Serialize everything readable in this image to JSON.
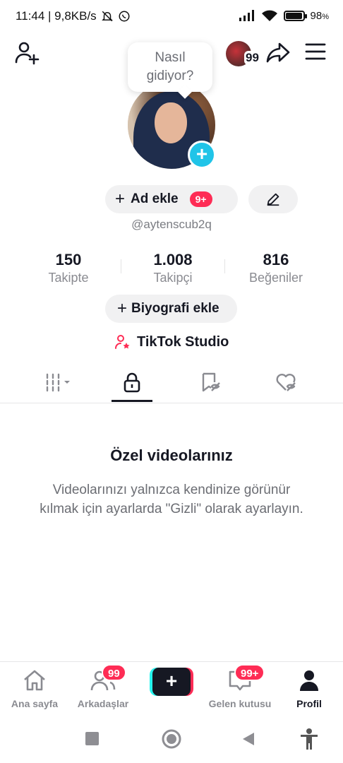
{
  "status_bar": {
    "time_info": "11:44 | 9,8KB/s",
    "battery": "98",
    "battery_suffix": "%",
    "battery_level": 0.98
  },
  "top_nav": {
    "mini_avatar_count": "99"
  },
  "profile": {
    "bubble_text_line1": "Nasıl",
    "bubble_text_line2": "gidiyor?",
    "ad_button": "Ad ekle",
    "ad_badge": "9+",
    "username": "@aytenscub2q",
    "bio_button": "Biyografi ekle",
    "studio_label": "TikTok Studio"
  },
  "stats": [
    {
      "value": "150",
      "label": "Takipte"
    },
    {
      "value": "1.008",
      "label": "Takipçi"
    },
    {
      "value": "816",
      "label": "Beğeniler"
    }
  ],
  "empty_state": {
    "title": "Özel videolarınız",
    "description": "Videolarınızı yalnızca kendinize görünür kılmak için ayarlarda \"Gizli\" olarak ayarlayın."
  },
  "bottom_nav": {
    "home": "Ana sayfa",
    "friends": "Arkadaşlar",
    "friends_badge": "99",
    "inbox": "Gelen kutusu",
    "inbox_badge": "99+",
    "profile": "Profil"
  },
  "colors": {
    "accent_red": "#fe2c55",
    "accent_cyan": "#25f4ee",
    "plus_badge": "#20c4e8",
    "text_primary": "#161823"
  }
}
